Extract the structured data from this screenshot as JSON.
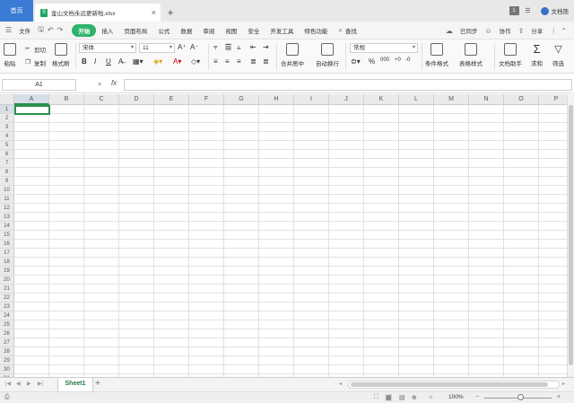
{
  "titlebar": {
    "home_tab": "首页",
    "doc_icon": "S",
    "doc_tab": "金山文档永远更新啦.xlsx",
    "close": "×",
    "add_tab": "+",
    "badge": "1",
    "user": "文档熊"
  },
  "menubar": {
    "file": "文件",
    "items": [
      "开始",
      "插入",
      "页面布局",
      "公式",
      "数据",
      "审阅",
      "视图",
      "安全",
      "开发工具",
      "特色功能"
    ],
    "search": "查找",
    "sync": "已同步",
    "collab": "协作",
    "share": "分享"
  },
  "ribbon": {
    "paste": "粘贴",
    "cut": "剪切",
    "copy": "复制",
    "format_painter": "格式刷",
    "font": "宋体",
    "size": "11",
    "bold": "B",
    "italic": "I",
    "underline": "U",
    "merge": "合并居中",
    "wrap": "自动换行",
    "number_format": "常规",
    "percent": "%",
    "conditional_format": "条件格式",
    "table_style": "表格样式",
    "doc_assistant": "文档助手",
    "sum": "求和",
    "filter": "筛选"
  },
  "formulabar": {
    "name_box": "A1",
    "fx": "fx"
  },
  "grid": {
    "columns": [
      "A",
      "B",
      "C",
      "D",
      "E",
      "F",
      "G",
      "H",
      "I",
      "J",
      "K",
      "L",
      "M",
      "N",
      "O",
      "P"
    ],
    "rows": [
      "1",
      "2",
      "3",
      "4",
      "5",
      "6",
      "7",
      "8",
      "9",
      "10",
      "11",
      "12",
      "13",
      "14",
      "15",
      "16",
      "17",
      "18",
      "19",
      "20",
      "21",
      "22",
      "23",
      "24",
      "25",
      "26",
      "27",
      "28",
      "29",
      "30",
      "31"
    ],
    "selected_cell": "A1"
  },
  "sheets": {
    "tabs": [
      "Sheet1"
    ],
    "add": "+"
  },
  "statusbar": {
    "zoom": "100%"
  }
}
